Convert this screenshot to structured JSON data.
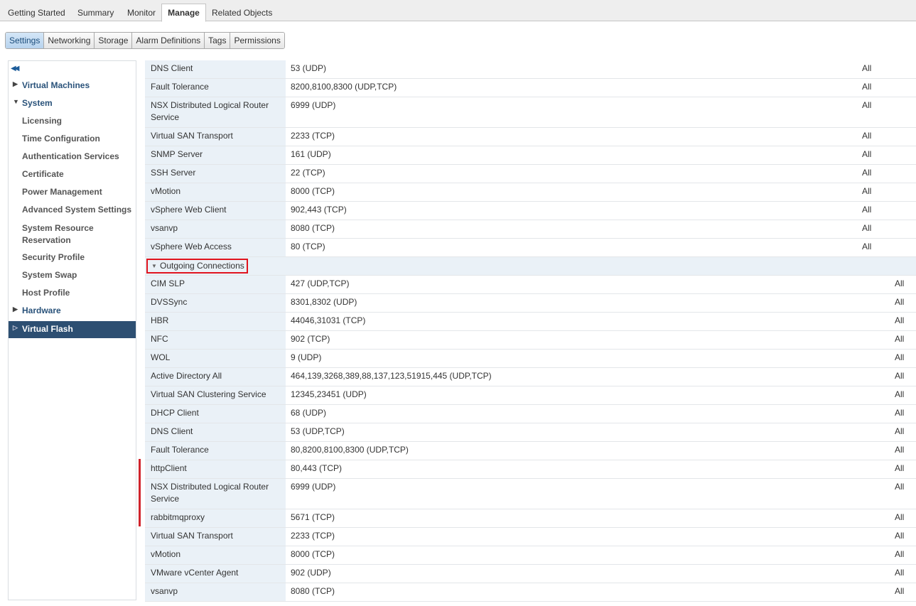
{
  "top_tabs": [
    "Getting Started",
    "Summary",
    "Monitor",
    "Manage",
    "Related Objects"
  ],
  "active_top_tab": "Manage",
  "sub_tabs": [
    "Settings",
    "Networking",
    "Storage",
    "Alarm Definitions",
    "Tags",
    "Permissions"
  ],
  "active_sub_tab": "Settings",
  "sidebar": {
    "collapse_icon": "double-chevron-left-icon",
    "items": [
      {
        "label": "Virtual Machines",
        "type": "top",
        "caret": "right"
      },
      {
        "label": "System",
        "type": "top",
        "caret": "down"
      },
      {
        "label": "Licensing",
        "type": "child"
      },
      {
        "label": "Time Configuration",
        "type": "child"
      },
      {
        "label": "Authentication Services",
        "type": "child"
      },
      {
        "label": "Certificate",
        "type": "child"
      },
      {
        "label": "Power Management",
        "type": "child"
      },
      {
        "label": "Advanced System Settings",
        "type": "child"
      },
      {
        "label": "System Resource Reservation",
        "type": "child"
      },
      {
        "label": "Security Profile",
        "type": "child"
      },
      {
        "label": "System Swap",
        "type": "child"
      },
      {
        "label": "Host Profile",
        "type": "child"
      },
      {
        "label": "Hardware",
        "type": "top",
        "caret": "right"
      },
      {
        "label": "Virtual Flash",
        "type": "top",
        "caret": "right-outline",
        "selected": true
      }
    ]
  },
  "incoming_rows": [
    {
      "name": "DNS Client",
      "ports": "53 (UDP)",
      "allowed": "All"
    },
    {
      "name": "Fault Tolerance",
      "ports": "8200,8100,8300 (UDP,TCP)",
      "allowed": "All"
    },
    {
      "name": "NSX Distributed Logical Router Service",
      "ports": "6999 (UDP)",
      "allowed": "All"
    },
    {
      "name": "Virtual SAN Transport",
      "ports": "2233 (TCP)",
      "allowed": "All"
    },
    {
      "name": "SNMP Server",
      "ports": "161 (UDP)",
      "allowed": "All"
    },
    {
      "name": "SSH Server",
      "ports": "22 (TCP)",
      "allowed": "All"
    },
    {
      "name": "vMotion",
      "ports": "8000 (TCP)",
      "allowed": "All"
    },
    {
      "name": "vSphere Web Client",
      "ports": "902,443 (TCP)",
      "allowed": "All"
    },
    {
      "name": "vsanvp",
      "ports": "8080 (TCP)",
      "allowed": "All"
    },
    {
      "name": "vSphere Web Access",
      "ports": "80 (TCP)",
      "allowed": "All"
    }
  ],
  "outgoing_group": {
    "label": "Outgoing Connections",
    "icon": "triangle-down-icon"
  },
  "outgoing_rows": [
    {
      "name": "CIM SLP",
      "ports": "427 (UDP,TCP)",
      "allowed": "All"
    },
    {
      "name": "DVSSync",
      "ports": "8301,8302 (UDP)",
      "allowed": "All"
    },
    {
      "name": "HBR",
      "ports": "44046,31031 (TCP)",
      "allowed": "All"
    },
    {
      "name": "NFC",
      "ports": "902 (TCP)",
      "allowed": "All"
    },
    {
      "name": "WOL",
      "ports": "9 (UDP)",
      "allowed": "All"
    },
    {
      "name": "Active Directory All",
      "ports": "464,139,3268,389,88,137,123,51915,445 (UDP,TCP)",
      "allowed": "All"
    },
    {
      "name": "Virtual SAN Clustering Service",
      "ports": "12345,23451 (UDP)",
      "allowed": "All"
    },
    {
      "name": "DHCP Client",
      "ports": "68 (UDP)",
      "allowed": "All"
    },
    {
      "name": "DNS Client",
      "ports": "53 (UDP,TCP)",
      "allowed": "All"
    },
    {
      "name": "Fault Tolerance",
      "ports": "80,8200,8100,8300 (UDP,TCP)",
      "allowed": "All"
    },
    {
      "name": "httpClient",
      "ports": "80,443 (TCP)",
      "allowed": "All"
    },
    {
      "name": "NSX Distributed Logical Router Service",
      "ports": "6999 (UDP)",
      "allowed": "All"
    },
    {
      "name": "rabbitmqproxy",
      "ports": "5671 (TCP)",
      "allowed": "All"
    },
    {
      "name": "Virtual SAN Transport",
      "ports": "2233 (TCP)",
      "allowed": "All"
    },
    {
      "name": "vMotion",
      "ports": "8000 (TCP)",
      "allowed": "All"
    },
    {
      "name": "VMware vCenter Agent",
      "ports": "902 (UDP)",
      "allowed": "All"
    },
    {
      "name": "vsanvp",
      "ports": "8080 (TCP)",
      "allowed": "All"
    }
  ],
  "colors": {
    "highlight_border": "#e0141e",
    "selected_nav": "#2d4f72",
    "name_cell_bg": "#eaf1f7"
  }
}
